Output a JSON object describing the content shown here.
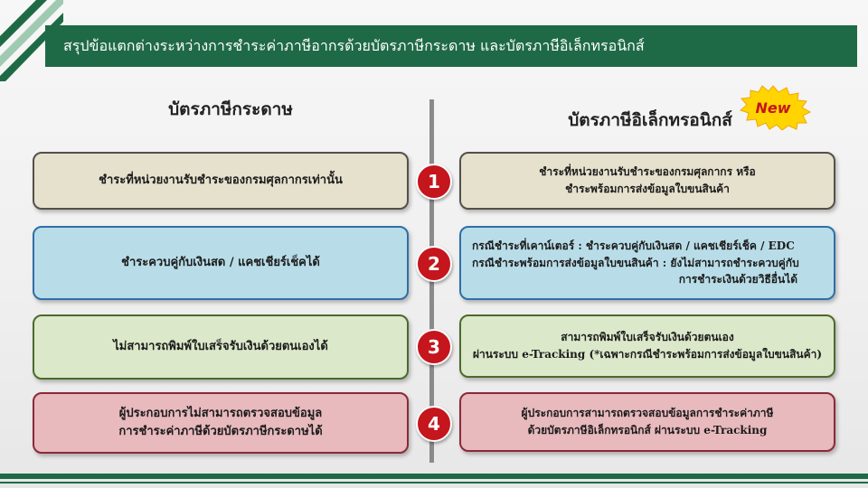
{
  "title": "สรุปข้อแตกต่างระหว่างการชำระค่าภาษีอากรด้วยบัตรภาษีกระดาษ และบัตรภาษีอิเล็กทรอนิกส์",
  "columns": {
    "left_heading": "บัตรภาษีกระดาษ",
    "right_heading": "บัตรภาษีอิเล็กทรอนิกส์",
    "new_badge": "New"
  },
  "rows": [
    {
      "number": "1",
      "left": [
        "ชำระที่หน่วยงานรับชำระของกรมศุลกากรเท่านั้น"
      ],
      "right": [
        "ชำระที่หน่วยงานรับชำระของกรมศุลกากร หรือ",
        "ชำระพร้อมการส่งข้อมูลใบขนสินค้า"
      ]
    },
    {
      "number": "2",
      "left": [
        "ชำระควบคู่กับเงินสด / แคชเชียร์เช็คได้"
      ],
      "right": [
        "กรณีชำระที่เคาน์เตอร์ : ชำระควบคู่กับเงินสด / แคชเชียร์เช็ค / EDC",
        "กรณีชำระพร้อมการส่งข้อมูลใบขนสินค้า : ยังไม่สามารถชำระควบคู่กับ",
        "การชำระเงินด้วยวิธีอื่นได้"
      ]
    },
    {
      "number": "3",
      "left": [
        "ไม่สามารถพิมพ์ใบเสร็จรับเงินด้วยตนเองได้"
      ],
      "right": [
        "สามารถพิมพ์ใบเสร็จรับเงินด้วยตนเอง",
        "ผ่านระบบ e-Tracking (*เฉพาะกรณีชำระพร้อมการส่งข้อมูลใบขนสินค้า)"
      ]
    },
    {
      "number": "4",
      "left": [
        "ผู้ประกอบการไม่สามารถตรวจสอบข้อมูล",
        "การชำระค่าภาษีด้วยบัตรภาษีกระดาษได้"
      ],
      "right": [
        "ผู้ประกอบการสามารถตรวจสอบข้อมูลการชำระค่าภาษี",
        "ด้วยบัตรภาษีอิเล็กทรอนิกส์ ผ่านระบบ e-Tracking"
      ]
    }
  ],
  "colors": {
    "brand_green": "#1f6a46",
    "number_red": "#c4161c",
    "row1": "#e6e1cd",
    "row2": "#b9dde8",
    "row3": "#dbe8c9",
    "row4": "#e8b9bd",
    "badge_yellow": "#ffd400",
    "badge_text": "#c4161c"
  }
}
